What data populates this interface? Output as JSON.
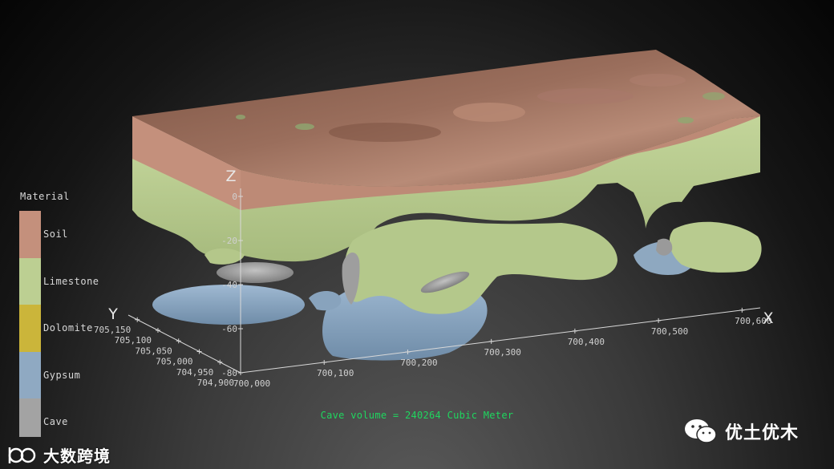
{
  "legend": {
    "title": "Material",
    "items": [
      {
        "label": "Soil",
        "color": "#c4907c"
      },
      {
        "label": "Limestone",
        "color": "#bccf92"
      },
      {
        "label": "Dolomite",
        "color": "#cbb53a"
      },
      {
        "label": "Gypsum",
        "color": "#8fa9c2"
      },
      {
        "label": "Cave",
        "color": "#a3a3a3"
      }
    ]
  },
  "axes": {
    "x_label": "X",
    "y_label": "Y",
    "z_label": "Z",
    "x_ticks": [
      "700,000",
      "700,100",
      "700,200",
      "700,300",
      "700,400",
      "700,500",
      "700,600"
    ],
    "y_ticks": [
      "704,900",
      "704,950",
      "705,000",
      "705,050",
      "705,100",
      "705,150"
    ],
    "z_ticks": [
      "0",
      "-20",
      "-40",
      "-60",
      "-80"
    ]
  },
  "caption": "Cave volume = 240264 Cubic Meter",
  "watermark_left": "大数跨境",
  "watermark_right": "优土优木",
  "colors": {
    "soil_top": "#8c6452",
    "soil_side": "#c4907c",
    "limestone": "#bccf92",
    "gypsum": "#8fa9c2",
    "cave": "#a3a3a3",
    "caption": "#1fd65f"
  }
}
